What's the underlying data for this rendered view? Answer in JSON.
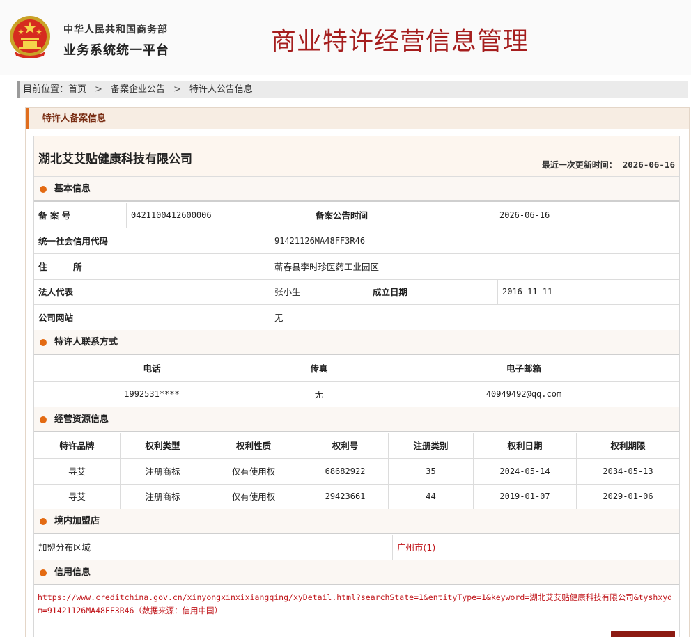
{
  "header": {
    "org_line1": "中华人民共和国商务部",
    "org_line2": "业务系统统一平台",
    "system_title": "商业特许经营信息管理",
    "emblem_icon": "national-emblem-icon"
  },
  "breadcrumb": {
    "prefix": "目前位置：",
    "items": [
      "首页",
      "备案企业公告",
      "特许人公告信息"
    ],
    "separator": ">"
  },
  "panel": {
    "title": "特许人备案信息"
  },
  "company": {
    "name": "湖北艾艾贴健康科技有限公司",
    "update_label": "最近一次更新时间：",
    "update_value": "2026-06-16"
  },
  "basic": {
    "title": "基本信息",
    "record_no_label": "备 案 号",
    "record_no": "0421100412600006",
    "announce_time_label": "备案公告时间",
    "announce_time": "2026-06-16",
    "credit_code_label": "统一社会信用代码",
    "credit_code": "91421126MA48FF3R46",
    "address_label": "住　　　所",
    "address": "蕲春县李时珍医药工业园区",
    "legal_rep_label": "法人代表",
    "legal_rep": "张小生",
    "established_label": "成立日期",
    "established": "2016-11-11",
    "website_label": "公司网站",
    "website": "无"
  },
  "contact": {
    "title": "特许人联系方式",
    "headers": [
      "电话",
      "传真",
      "电子邮箱"
    ],
    "phone": "1992531****",
    "fax": "无",
    "email": "40949492@qq.com"
  },
  "resources": {
    "title": "经营资源信息",
    "headers": [
      "特许品牌",
      "权利类型",
      "权利性质",
      "权利号",
      "注册类别",
      "权利日期",
      "权利期限"
    ],
    "rows": [
      [
        "寻艾",
        "注册商标",
        "仅有使用权",
        "68682922",
        "35",
        "2024-05-14",
        "2034-05-13"
      ],
      [
        "寻艾",
        "注册商标",
        "仅有使用权",
        "29423661",
        "44",
        "2019-01-07",
        "2029-01-06"
      ]
    ]
  },
  "stores": {
    "title": "境内加盟店",
    "region_label": "加盟分布区域",
    "region_value": "广州市(1)"
  },
  "credit": {
    "title": "信用信息",
    "url_text": "https://www.creditchina.gov.cn/xinyongxinxixiangqing/xyDetail.html?searchState=1&entityType=1&keyword=湖北艾艾贴健康科技有限公司&tyshxydm=91421126MA48FF3R46（数据来源：信用中国）"
  },
  "colors": {
    "brand_red": "#a51e1e",
    "accent_orange": "#e36a12",
    "link_red": "#c0151a",
    "panel_bg": "#f7ede3"
  }
}
